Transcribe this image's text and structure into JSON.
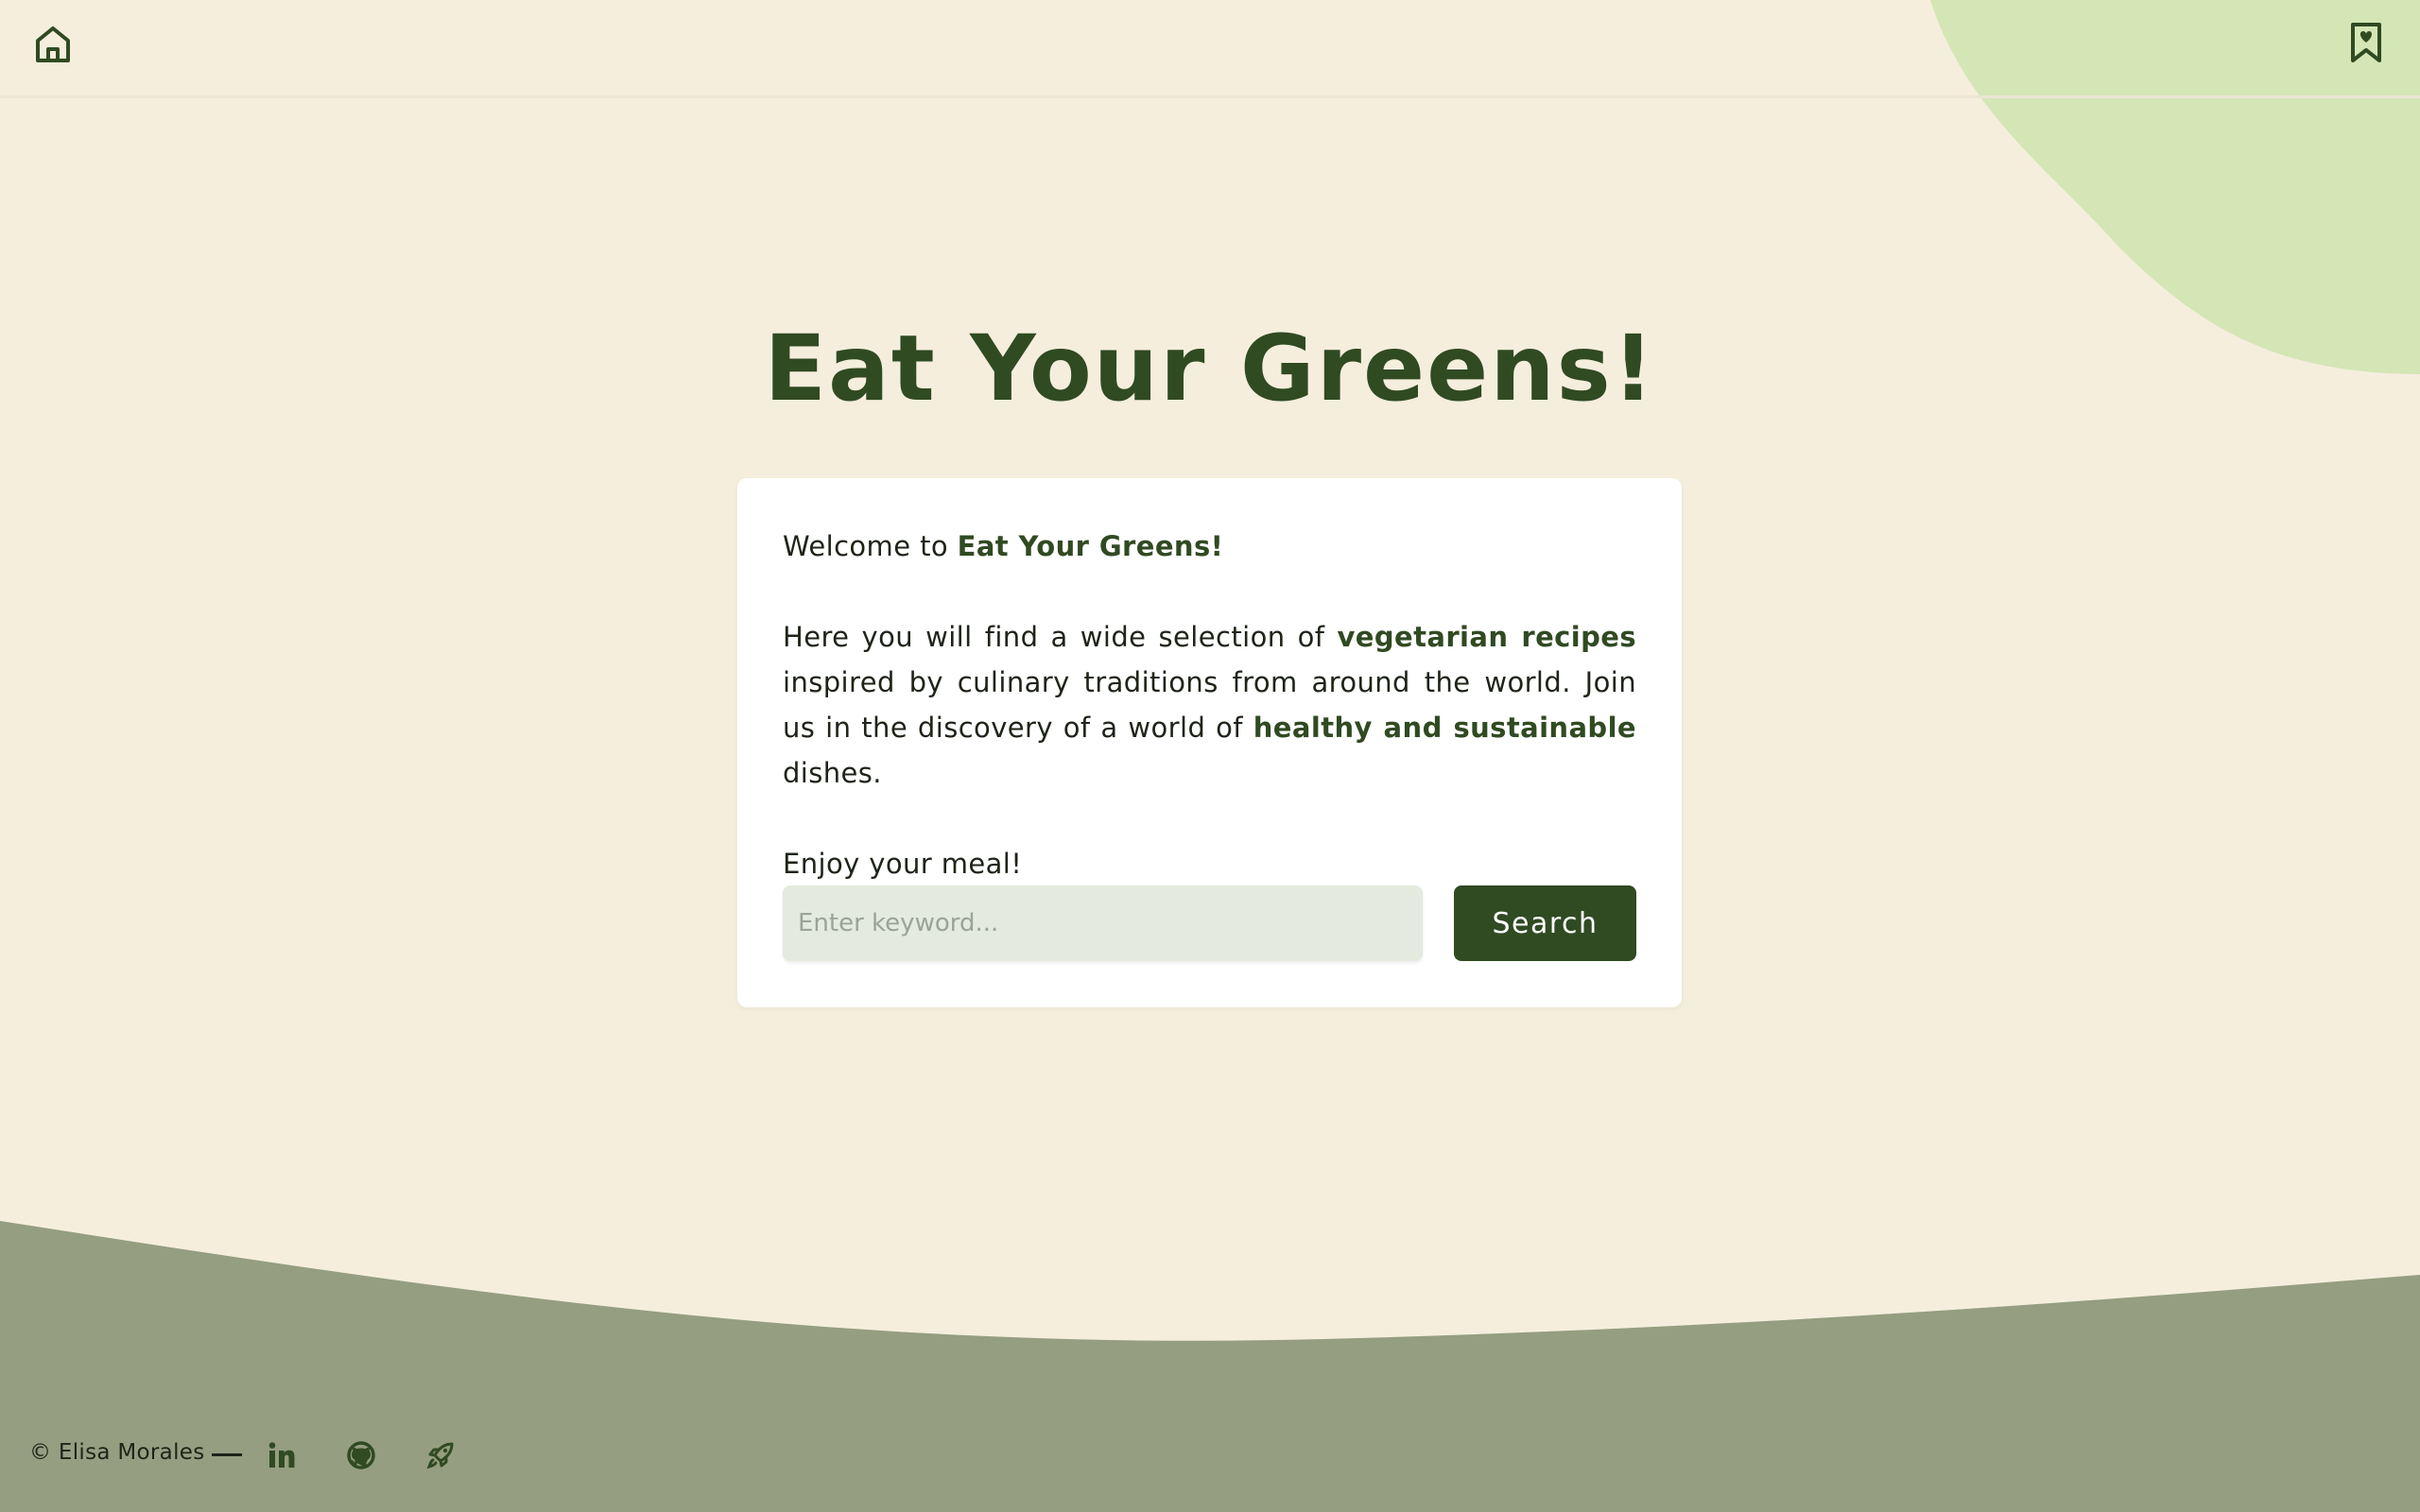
{
  "header": {
    "home_icon": "home-icon",
    "saved_icon": "bookmark-heart-icon"
  },
  "title": "Eat Your Greens!",
  "card": {
    "welcome_prefix": "Welcome to ",
    "welcome_brand": "Eat Your Greens!",
    "intro_part1": "Here you will find a wide selection of ",
    "intro_hl1": "vegetarian recipes",
    "intro_part2": " inspired by culinary traditions from around the world. Join us in the discovery of a world of ",
    "intro_hl2": "healthy and sustainable",
    "intro_part3": " dishes.",
    "closing": "Enjoy your meal!"
  },
  "search": {
    "placeholder": "Enter keyword...",
    "value": "",
    "button_label": "Search"
  },
  "footer": {
    "copyright": "© Elisa Morales",
    "social": [
      "linkedin-icon",
      "github-icon",
      "rocket-icon"
    ]
  },
  "colors": {
    "background": "#f5eedd",
    "accent": "#304a22",
    "blob": "#d4e6b5",
    "footer_wave": "#959e80",
    "input_bg": "#e4eadd"
  }
}
